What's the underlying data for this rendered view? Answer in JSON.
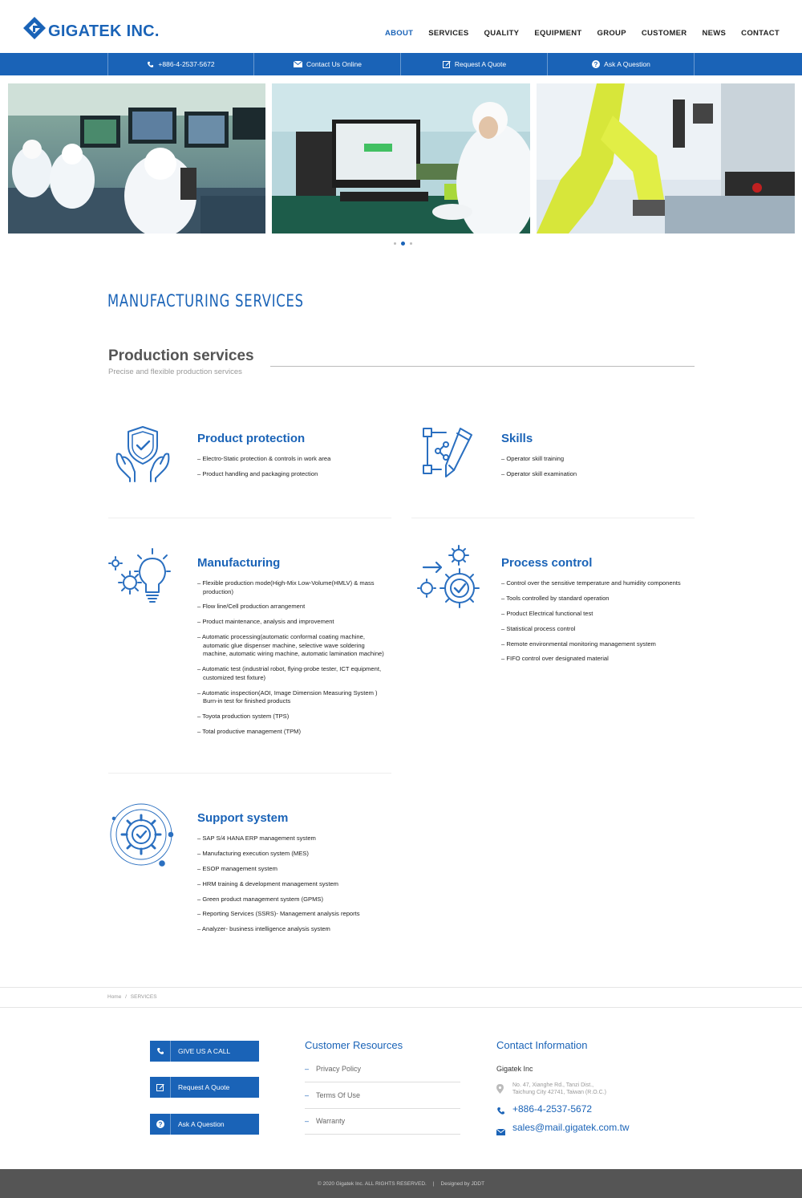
{
  "brand": {
    "name": "GIGATEK INC.",
    "color": "#1a63b7"
  },
  "nav": [
    {
      "label": "ABOUT",
      "active": true
    },
    {
      "label": "SERVICES"
    },
    {
      "label": "QUALITY"
    },
    {
      "label": "EQUIPMENT"
    },
    {
      "label": "GROUP"
    },
    {
      "label": "CUSTOMER"
    },
    {
      "label": "NEWS"
    },
    {
      "label": "CONTACT"
    }
  ],
  "topbar": [
    {
      "icon": "phone-icon",
      "label": "+886-4-2537-5672"
    },
    {
      "icon": "envelope-icon",
      "label": "Contact Us Online"
    },
    {
      "icon": "edit-icon",
      "label": "Request A  Quote"
    },
    {
      "icon": "question-icon",
      "label": "Ask A Question"
    }
  ],
  "banner": {
    "slides": 3,
    "active_slide": 2
  },
  "page_title": "MANUFACTURING SERVICES",
  "section": {
    "title": "Production services",
    "subtitle": "Precise and flexible production services"
  },
  "cards": {
    "protection": {
      "title": "Product protection",
      "items": [
        "– Electro-Static protection & controls in work area",
        "– Product handling and packaging protection"
      ]
    },
    "skills": {
      "title": "Skills",
      "items": [
        "– Operator skill training",
        "– Operator skill examination"
      ]
    },
    "manufacturing": {
      "title": "Manufacturing",
      "items": [
        "– Flexible production mode(High-Mix Low-Volume(HMLV) & mass production)",
        "– Flow line/Cell production arrangement",
        "– Product maintenance, analysis and improvement",
        "– Automatic processing(automatic conformal coating machine, automatic glue dispenser machine, selective wave soldering machine, automatic wiring machine, automatic lamination machine)",
        "– Automatic test (industrial robot, flying-probe tester, ICT equipment, customized test fixture)",
        "– Automatic inspection(AOI, Image Dimension Measuring System ) Burn-in test for finished products",
        "– Toyota production system (TPS)",
        "– Total productive management (TPM)"
      ]
    },
    "process": {
      "title": "Process control",
      "items": [
        "– Control over the sensitive temperature and humidity components",
        "– Tools controlled by standard operation",
        "– Product Electrical functional test",
        "– Statistical process control",
        "– Remote environmental monitoring management system",
        "– FIFO control over designated material"
      ]
    },
    "support": {
      "title": "Support system",
      "items": [
        "– SAP S/4 HANA ERP management system",
        "– Manufacturing execution system (MES)",
        "– ESOP management system",
        "– HRM training & development management system",
        "– Green product management system (GPMS)",
        "– Reporting Services (SSRS)- Management analysis reports",
        "– Analyzer- business intelligence analysis system"
      ]
    }
  },
  "breadcrumb": {
    "home": "Home",
    "sep": "/",
    "current": "SERVICES"
  },
  "footer": {
    "buttons": [
      {
        "icon": "phone-icon",
        "label": "GIVE US A CALL"
      },
      {
        "icon": "edit-icon",
        "label": "Request A  Quote"
      },
      {
        "icon": "question-icon",
        "label": "Ask A Question"
      }
    ],
    "resources": {
      "title": "Customer Resources",
      "items": [
        "Privacy Policy",
        "Terms Of Use",
        "Warranty"
      ]
    },
    "contact": {
      "title": "Contact Information",
      "company": "Gigatek Inc",
      "address_1": "No. 47, Xianghe Rd., Tanzi Dist.,",
      "address_2": "Taichung City 42741, Taiwan (R.O.C.)",
      "phone": "+886-4-2537-5672",
      "email": "sales@mail.gigatek.com.tw"
    },
    "copyright": "© 2020 Gigatek Inc. ALL RIGHTS RESERVED.",
    "divider": "|",
    "designer": "Designed by JDDT"
  }
}
